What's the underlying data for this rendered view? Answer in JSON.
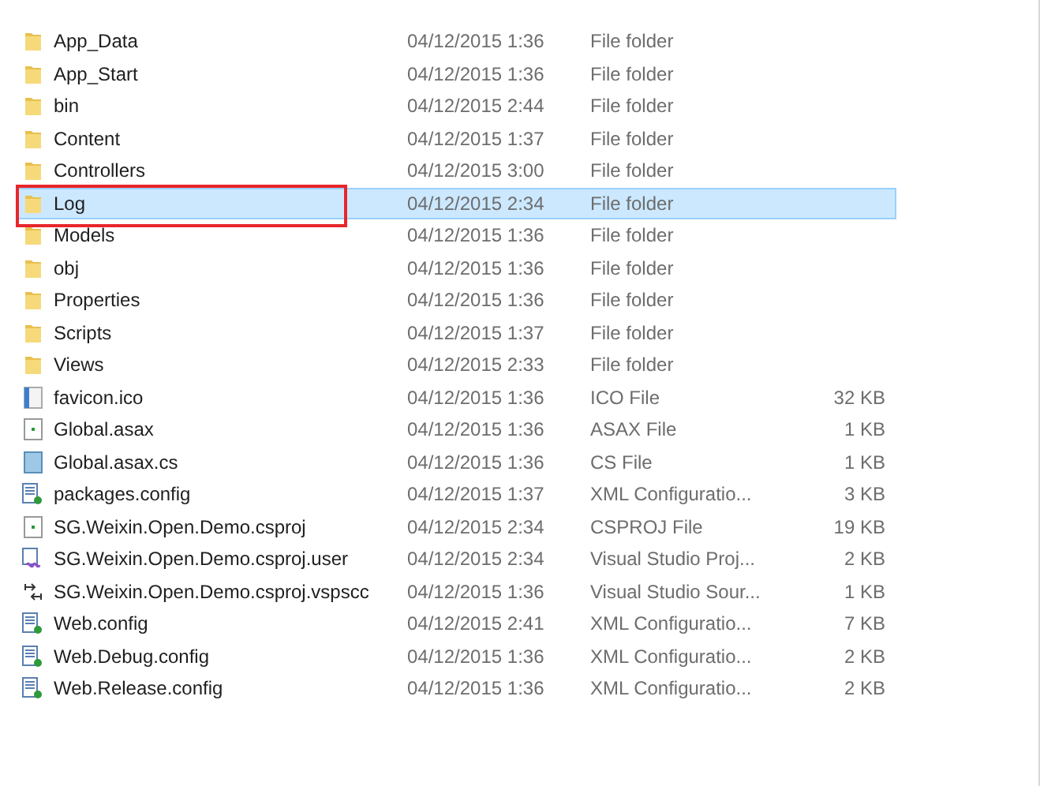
{
  "files": [
    {
      "name": "App_Data",
      "date": "04/12/2015 1:36",
      "type": "File folder",
      "kind": "folder",
      "selected": false,
      "annotated": false
    },
    {
      "name": "App_Start",
      "date": "04/12/2015 1:36",
      "type": "File folder",
      "kind": "folder",
      "selected": false,
      "annotated": false
    },
    {
      "name": "bin",
      "date": "04/12/2015 2:44",
      "type": "File folder",
      "kind": "folder",
      "selected": false,
      "annotated": false
    },
    {
      "name": "Content",
      "date": "04/12/2015 1:37",
      "type": "File folder",
      "kind": "folder",
      "selected": false,
      "annotated": false
    },
    {
      "name": "Controllers",
      "date": "04/12/2015 3:00",
      "type": "File folder",
      "kind": "folder",
      "selected": false,
      "annotated": false
    },
    {
      "name": "Log",
      "date": "04/12/2015 2:34",
      "type": "File folder",
      "kind": "folder",
      "selected": true,
      "annotated": true
    },
    {
      "name": "Models",
      "date": "04/12/2015 1:36",
      "type": "File folder",
      "kind": "folder",
      "selected": false,
      "annotated": false
    },
    {
      "name": "obj",
      "date": "04/12/2015 1:36",
      "type": "File folder",
      "kind": "folder",
      "selected": false,
      "annotated": false
    },
    {
      "name": "Properties",
      "date": "04/12/2015 1:36",
      "type": "File folder",
      "kind": "folder",
      "selected": false,
      "annotated": false
    },
    {
      "name": "Scripts",
      "date": "04/12/2015 1:37",
      "type": "File folder",
      "kind": "folder",
      "selected": false,
      "annotated": false
    },
    {
      "name": "Views",
      "date": "04/12/2015 2:33",
      "type": "File folder",
      "kind": "folder",
      "selected": false,
      "annotated": false
    },
    {
      "name": "favicon.ico",
      "date": "04/12/2015 1:36",
      "type": "ICO File",
      "size": "32 KB",
      "kind": "image",
      "selected": false,
      "annotated": false
    },
    {
      "name": "Global.asax",
      "date": "04/12/2015 1:36",
      "type": "ASAX File",
      "size": "1 KB",
      "kind": "page",
      "selected": false,
      "annotated": false
    },
    {
      "name": "Global.asax.cs",
      "date": "04/12/2015 1:36",
      "type": "CS File",
      "size": "1 KB",
      "kind": "code",
      "selected": false,
      "annotated": false
    },
    {
      "name": "packages.config",
      "date": "04/12/2015 1:37",
      "type": "XML Configuratio...",
      "size": "3 KB",
      "kind": "config",
      "selected": false,
      "annotated": false
    },
    {
      "name": "SG.Weixin.Open.Demo.csproj",
      "date": "04/12/2015 2:34",
      "type": "CSPROJ File",
      "size": "19 KB",
      "kind": "page",
      "selected": false,
      "annotated": false
    },
    {
      "name": "SG.Weixin.Open.Demo.csproj.user",
      "date": "04/12/2015 2:34",
      "type": "Visual Studio Proj...",
      "size": "2 KB",
      "kind": "vsuser",
      "selected": false,
      "annotated": false
    },
    {
      "name": "SG.Weixin.Open.Demo.csproj.vspscc",
      "date": "04/12/2015 1:36",
      "type": "Visual Studio Sour...",
      "size": "1 KB",
      "kind": "vspscc",
      "selected": false,
      "annotated": false
    },
    {
      "name": "Web.config",
      "date": "04/12/2015 2:41",
      "type": "XML Configuratio...",
      "size": "7 KB",
      "kind": "config",
      "selected": false,
      "annotated": false
    },
    {
      "name": "Web.Debug.config",
      "date": "04/12/2015 1:36",
      "type": "XML Configuratio...",
      "size": "2 KB",
      "kind": "config",
      "selected": false,
      "annotated": false
    },
    {
      "name": "Web.Release.config",
      "date": "04/12/2015 1:36",
      "type": "XML Configuratio...",
      "size": "2 KB",
      "kind": "config",
      "selected": false,
      "annotated": false
    }
  ]
}
